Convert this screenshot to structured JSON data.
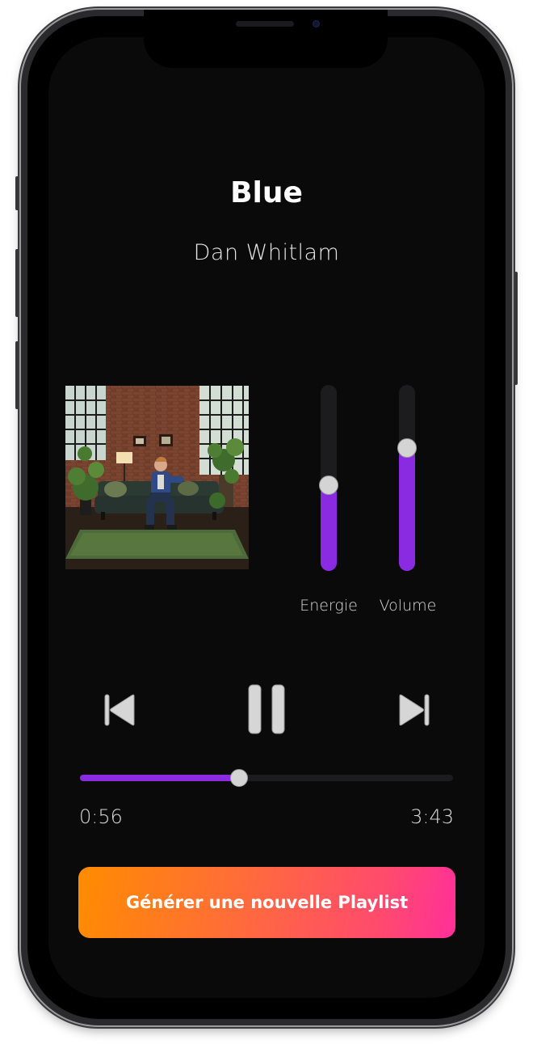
{
  "track": {
    "title": "Blue",
    "artist": "Dan Whitlam"
  },
  "sliders": {
    "energy": {
      "label": "Energie",
      "value": 0.46
    },
    "volume": {
      "label": "Volume",
      "value": 0.66
    }
  },
  "playback": {
    "elapsed": "0:56",
    "duration": "3:43",
    "progress": 0.427,
    "state": "playing"
  },
  "icons": {
    "previous": "skip-previous-icon",
    "pause": "pause-icon",
    "next": "skip-next-icon"
  },
  "cta": {
    "label": "Générer une nouvelle Playlist"
  },
  "colors": {
    "accent": "#8a2be2",
    "knob": "#d4d4d4",
    "background": "#0a0a0b",
    "gradient_start": "#ff8c00",
    "gradient_end": "#ff2f9a"
  }
}
